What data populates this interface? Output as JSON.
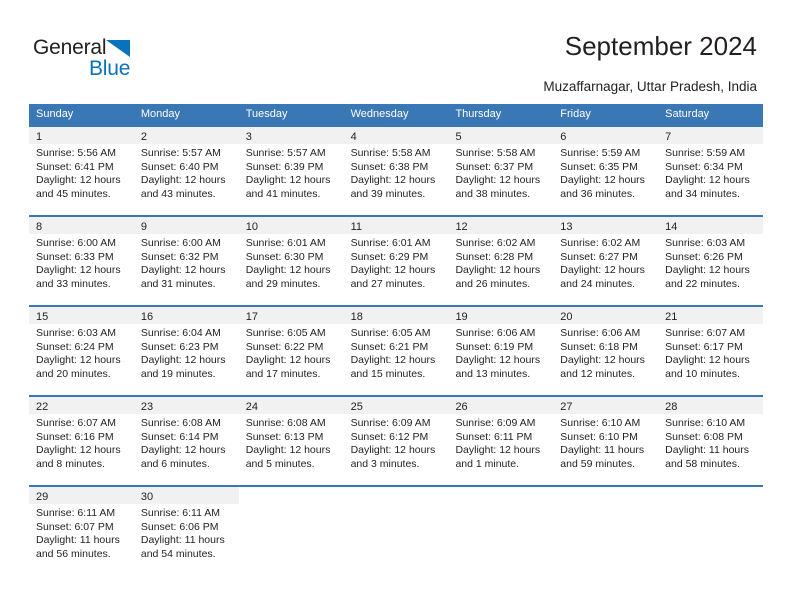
{
  "brand": {
    "name_part1": "General",
    "name_part2": "Blue",
    "accent_color": "#0a72bb",
    "triangle_icon": "triangle-icon"
  },
  "header": {
    "title": "September 2024",
    "subtitle": "Muzaffarnagar, Uttar Pradesh, India"
  },
  "colors": {
    "header_row": "#3a77b5",
    "day_band": "#f1f1f1",
    "text": "#231f20"
  },
  "weekdays": [
    "Sunday",
    "Monday",
    "Tuesday",
    "Wednesday",
    "Thursday",
    "Friday",
    "Saturday"
  ],
  "weeks": [
    {
      "days": [
        {
          "num": "1",
          "sunrise": "Sunrise: 5:56 AM",
          "sunset": "Sunset: 6:41 PM",
          "daylight_1": "Daylight: 12 hours",
          "daylight_2": "and 45 minutes."
        },
        {
          "num": "2",
          "sunrise": "Sunrise: 5:57 AM",
          "sunset": "Sunset: 6:40 PM",
          "daylight_1": "Daylight: 12 hours",
          "daylight_2": "and 43 minutes."
        },
        {
          "num": "3",
          "sunrise": "Sunrise: 5:57 AM",
          "sunset": "Sunset: 6:39 PM",
          "daylight_1": "Daylight: 12 hours",
          "daylight_2": "and 41 minutes."
        },
        {
          "num": "4",
          "sunrise": "Sunrise: 5:58 AM",
          "sunset": "Sunset: 6:38 PM",
          "daylight_1": "Daylight: 12 hours",
          "daylight_2": "and 39 minutes."
        },
        {
          "num": "5",
          "sunrise": "Sunrise: 5:58 AM",
          "sunset": "Sunset: 6:37 PM",
          "daylight_1": "Daylight: 12 hours",
          "daylight_2": "and 38 minutes."
        },
        {
          "num": "6",
          "sunrise": "Sunrise: 5:59 AM",
          "sunset": "Sunset: 6:35 PM",
          "daylight_1": "Daylight: 12 hours",
          "daylight_2": "and 36 minutes."
        },
        {
          "num": "7",
          "sunrise": "Sunrise: 5:59 AM",
          "sunset": "Sunset: 6:34 PM",
          "daylight_1": "Daylight: 12 hours",
          "daylight_2": "and 34 minutes."
        }
      ]
    },
    {
      "days": [
        {
          "num": "8",
          "sunrise": "Sunrise: 6:00 AM",
          "sunset": "Sunset: 6:33 PM",
          "daylight_1": "Daylight: 12 hours",
          "daylight_2": "and 33 minutes."
        },
        {
          "num": "9",
          "sunrise": "Sunrise: 6:00 AM",
          "sunset": "Sunset: 6:32 PM",
          "daylight_1": "Daylight: 12 hours",
          "daylight_2": "and 31 minutes."
        },
        {
          "num": "10",
          "sunrise": "Sunrise: 6:01 AM",
          "sunset": "Sunset: 6:30 PM",
          "daylight_1": "Daylight: 12 hours",
          "daylight_2": "and 29 minutes."
        },
        {
          "num": "11",
          "sunrise": "Sunrise: 6:01 AM",
          "sunset": "Sunset: 6:29 PM",
          "daylight_1": "Daylight: 12 hours",
          "daylight_2": "and 27 minutes."
        },
        {
          "num": "12",
          "sunrise": "Sunrise: 6:02 AM",
          "sunset": "Sunset: 6:28 PM",
          "daylight_1": "Daylight: 12 hours",
          "daylight_2": "and 26 minutes."
        },
        {
          "num": "13",
          "sunrise": "Sunrise: 6:02 AM",
          "sunset": "Sunset: 6:27 PM",
          "daylight_1": "Daylight: 12 hours",
          "daylight_2": "and 24 minutes."
        },
        {
          "num": "14",
          "sunrise": "Sunrise: 6:03 AM",
          "sunset": "Sunset: 6:26 PM",
          "daylight_1": "Daylight: 12 hours",
          "daylight_2": "and 22 minutes."
        }
      ]
    },
    {
      "days": [
        {
          "num": "15",
          "sunrise": "Sunrise: 6:03 AM",
          "sunset": "Sunset: 6:24 PM",
          "daylight_1": "Daylight: 12 hours",
          "daylight_2": "and 20 minutes."
        },
        {
          "num": "16",
          "sunrise": "Sunrise: 6:04 AM",
          "sunset": "Sunset: 6:23 PM",
          "daylight_1": "Daylight: 12 hours",
          "daylight_2": "and 19 minutes."
        },
        {
          "num": "17",
          "sunrise": "Sunrise: 6:05 AM",
          "sunset": "Sunset: 6:22 PM",
          "daylight_1": "Daylight: 12 hours",
          "daylight_2": "and 17 minutes."
        },
        {
          "num": "18",
          "sunrise": "Sunrise: 6:05 AM",
          "sunset": "Sunset: 6:21 PM",
          "daylight_1": "Daylight: 12 hours",
          "daylight_2": "and 15 minutes."
        },
        {
          "num": "19",
          "sunrise": "Sunrise: 6:06 AM",
          "sunset": "Sunset: 6:19 PM",
          "daylight_1": "Daylight: 12 hours",
          "daylight_2": "and 13 minutes."
        },
        {
          "num": "20",
          "sunrise": "Sunrise: 6:06 AM",
          "sunset": "Sunset: 6:18 PM",
          "daylight_1": "Daylight: 12 hours",
          "daylight_2": "and 12 minutes."
        },
        {
          "num": "21",
          "sunrise": "Sunrise: 6:07 AM",
          "sunset": "Sunset: 6:17 PM",
          "daylight_1": "Daylight: 12 hours",
          "daylight_2": "and 10 minutes."
        }
      ]
    },
    {
      "days": [
        {
          "num": "22",
          "sunrise": "Sunrise: 6:07 AM",
          "sunset": "Sunset: 6:16 PM",
          "daylight_1": "Daylight: 12 hours",
          "daylight_2": "and 8 minutes."
        },
        {
          "num": "23",
          "sunrise": "Sunrise: 6:08 AM",
          "sunset": "Sunset: 6:14 PM",
          "daylight_1": "Daylight: 12 hours",
          "daylight_2": "and 6 minutes."
        },
        {
          "num": "24",
          "sunrise": "Sunrise: 6:08 AM",
          "sunset": "Sunset: 6:13 PM",
          "daylight_1": "Daylight: 12 hours",
          "daylight_2": "and 5 minutes."
        },
        {
          "num": "25",
          "sunrise": "Sunrise: 6:09 AM",
          "sunset": "Sunset: 6:12 PM",
          "daylight_1": "Daylight: 12 hours",
          "daylight_2": "and 3 minutes."
        },
        {
          "num": "26",
          "sunrise": "Sunrise: 6:09 AM",
          "sunset": "Sunset: 6:11 PM",
          "daylight_1": "Daylight: 12 hours",
          "daylight_2": "and 1 minute."
        },
        {
          "num": "27",
          "sunrise": "Sunrise: 6:10 AM",
          "sunset": "Sunset: 6:10 PM",
          "daylight_1": "Daylight: 11 hours",
          "daylight_2": "and 59 minutes."
        },
        {
          "num": "28",
          "sunrise": "Sunrise: 6:10 AM",
          "sunset": "Sunset: 6:08 PM",
          "daylight_1": "Daylight: 11 hours",
          "daylight_2": "and 58 minutes."
        }
      ]
    },
    {
      "days": [
        {
          "num": "29",
          "sunrise": "Sunrise: 6:11 AM",
          "sunset": "Sunset: 6:07 PM",
          "daylight_1": "Daylight: 11 hours",
          "daylight_2": "and 56 minutes."
        },
        {
          "num": "30",
          "sunrise": "Sunrise: 6:11 AM",
          "sunset": "Sunset: 6:06 PM",
          "daylight_1": "Daylight: 11 hours",
          "daylight_2": "and 54 minutes."
        },
        {
          "num": "",
          "sunrise": "",
          "sunset": "",
          "daylight_1": "",
          "daylight_2": ""
        },
        {
          "num": "",
          "sunrise": "",
          "sunset": "",
          "daylight_1": "",
          "daylight_2": ""
        },
        {
          "num": "",
          "sunrise": "",
          "sunset": "",
          "daylight_1": "",
          "daylight_2": ""
        },
        {
          "num": "",
          "sunrise": "",
          "sunset": "",
          "daylight_1": "",
          "daylight_2": ""
        },
        {
          "num": "",
          "sunrise": "",
          "sunset": "",
          "daylight_1": "",
          "daylight_2": ""
        }
      ]
    }
  ]
}
